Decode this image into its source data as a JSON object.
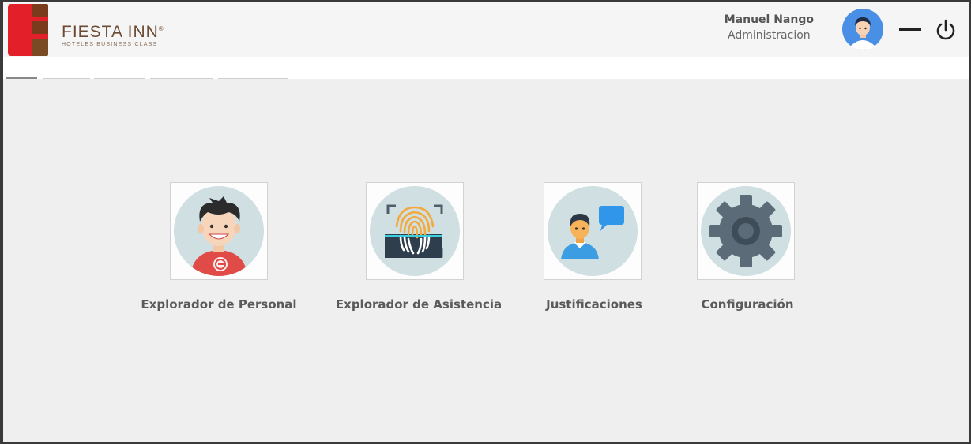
{
  "brand": {
    "name": "FIESTA INN",
    "registered_mark": "®",
    "tagline": "HOTELES BUSINESS CLASS"
  },
  "user": {
    "name": "Manuel Nango",
    "role": "Administracion"
  },
  "header_icons": [
    "avatar-icon",
    "minimize-icon",
    "power-icon"
  ],
  "modules": [
    {
      "label": "Explorador de Personal",
      "icon": "person-icon"
    },
    {
      "label": "Explorador de Asistencia",
      "icon": "fingerprint-icon"
    },
    {
      "label": "Justificaciones",
      "icon": "person-chat-icon"
    },
    {
      "label": "Configuración",
      "icon": "gear-icon"
    }
  ],
  "colors": {
    "brand_red": "#e3202a",
    "brand_brown": "#6b4a33",
    "tile_circle": "#cfdfe2"
  }
}
